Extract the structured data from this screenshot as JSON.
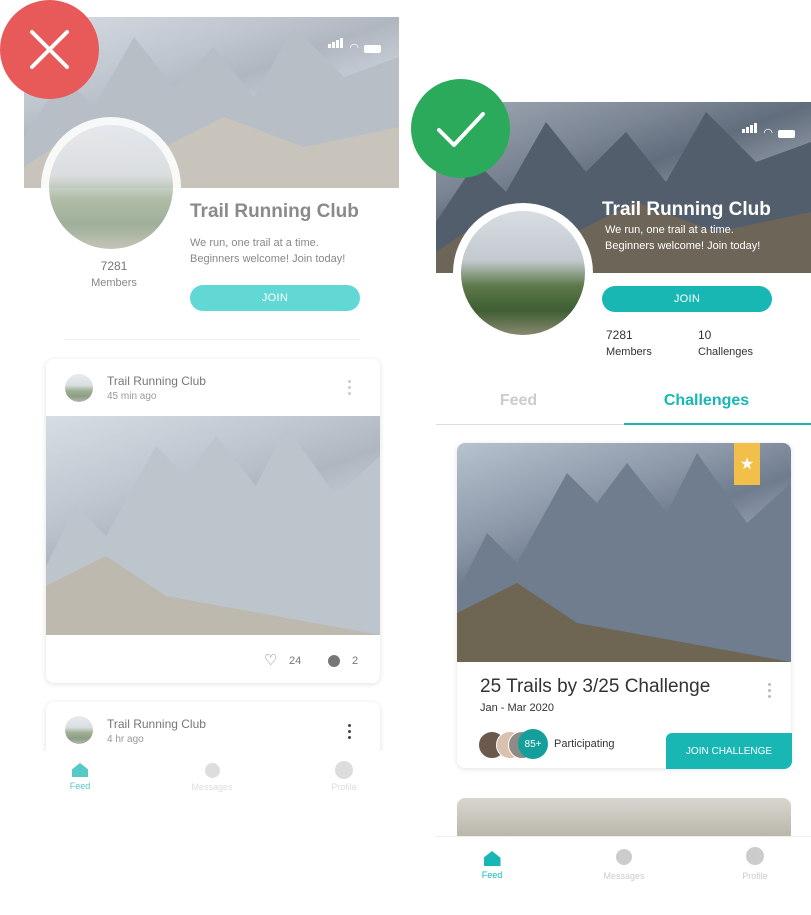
{
  "colors": {
    "teal": "#18b7b3",
    "teal_light": "#62d8d4",
    "red": "#e85a5a",
    "green": "#2aaa5a",
    "gold": "#f2c04a"
  },
  "left": {
    "badge_icon": "x-icon",
    "club": {
      "title": "Trail Running Club",
      "description_line1": "We run, one trail at a time.",
      "description_line2": "Beginners welcome! Join today!",
      "members_count": "7281",
      "members_label": "Members",
      "join_label": "JOIN"
    },
    "posts": [
      {
        "author": "Trail Running Club",
        "time": "45 min ago",
        "likes": "24",
        "comments": "2"
      },
      {
        "author": "Trail Running Club",
        "time": "4 hr ago"
      }
    ],
    "nav": [
      {
        "label": "Feed",
        "icon": "home-icon"
      },
      {
        "label": "Messages",
        "icon": "chat-icon"
      },
      {
        "label": "Profile",
        "icon": "user-icon"
      }
    ]
  },
  "right": {
    "badge_icon": "check-icon",
    "club": {
      "title": "Trail Running Club",
      "description_line1": "We run, one trail at a time.",
      "description_line2": "Beginners welcome! Join today!",
      "join_label": "JOIN",
      "members_count": "7281",
      "members_label": "Members",
      "challenges_count": "10",
      "challenges_label": "Challenges"
    },
    "tabs": {
      "feed": "Feed",
      "challenges": "Challenges"
    },
    "challenge": {
      "title": "25 Trails by 3/25 Challenge",
      "dates": "Jan - Mar 2020",
      "participants_badge": "85+",
      "participating_label": "Participating",
      "join_label": "JOIN CHALLENGE"
    },
    "nav": [
      {
        "label": "Feed",
        "icon": "home-icon"
      },
      {
        "label": "Messages",
        "icon": "chat-icon"
      },
      {
        "label": "Profile",
        "icon": "user-icon"
      }
    ]
  }
}
